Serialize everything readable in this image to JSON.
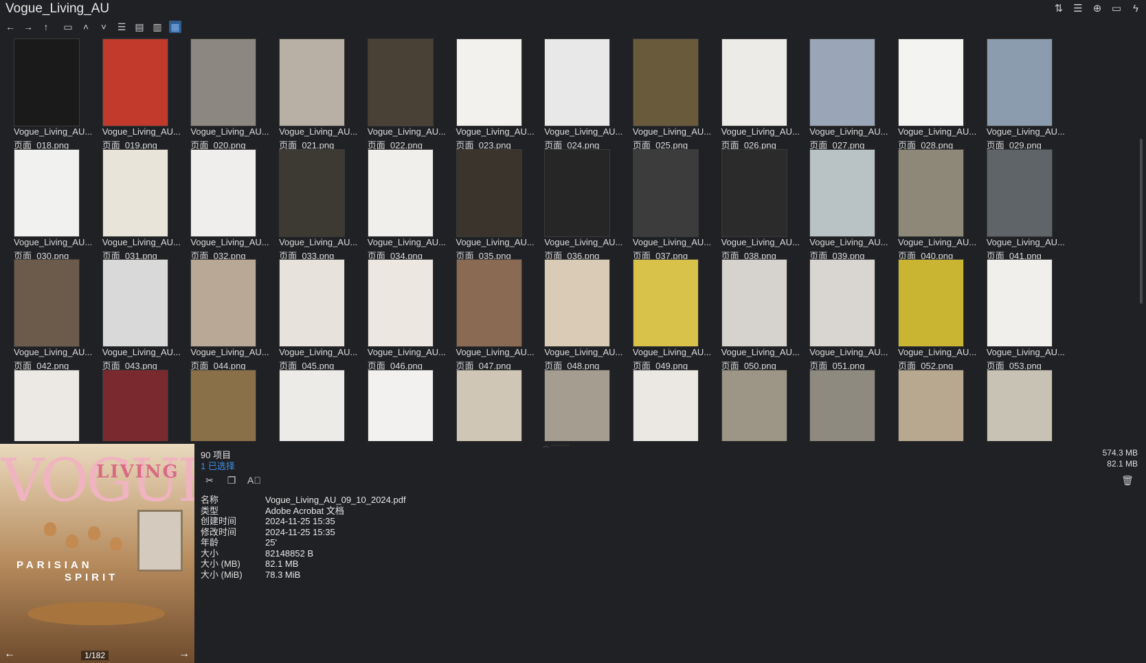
{
  "window": {
    "title": "Vogue_Living_AU"
  },
  "titlebar_icons": [
    "sort-icon",
    "details-icon",
    "add-icon",
    "clipboard-icon",
    "lightning-icon"
  ],
  "toolbar": {
    "buttons": [
      "back-icon",
      "forward-icon",
      "up-icon",
      "window-icon",
      "chevron-up-icon",
      "chevron-down-icon",
      "list-view-icon",
      "details-view-icon",
      "tree-view-icon",
      "grid-view-icon"
    ],
    "active": "grid-view-icon"
  },
  "files": [
    {
      "name": "Vogue_Living_AU...",
      "page": "页面_018.png",
      "color": "#1a1a1a"
    },
    {
      "name": "Vogue_Living_AU...",
      "page": "页面_019.png",
      "color": "#c23a2b"
    },
    {
      "name": "Vogue_Living_AU...",
      "page": "页面_020.png",
      "color": "#8c8780"
    },
    {
      "name": "Vogue_Living_AU...",
      "page": "页面_021.png",
      "color": "#b8b0a4"
    },
    {
      "name": "Vogue_Living_AU...",
      "page": "页面_022.png",
      "color": "#4a4136"
    },
    {
      "name": "Vogue_Living_AU...",
      "page": "页面_023.png",
      "color": "#f2f1ee"
    },
    {
      "name": "Vogue_Living_AU...",
      "page": "页面_024.png",
      "color": "#e8e8e8"
    },
    {
      "name": "Vogue_Living_AU...",
      "page": "页面_025.png",
      "color": "#6a5a3c"
    },
    {
      "name": "Vogue_Living_AU...",
      "page": "页面_026.png",
      "color": "#ecebe8"
    },
    {
      "name": "Vogue_Living_AU...",
      "page": "页面_027.png",
      "color": "#9aa6b8"
    },
    {
      "name": "Vogue_Living_AU...",
      "page": "页面_028.png",
      "color": "#f3f3f1"
    },
    {
      "name": "Vogue_Living_AU...",
      "page": "页面_029.png",
      "color": "#8a9cae"
    },
    {
      "name": "Vogue_Living_AU...",
      "page": "页面_030.png",
      "color": "#f1f1f0"
    },
    {
      "name": "Vogue_Living_AU...",
      "page": "页面_031.png",
      "color": "#e9e4da"
    },
    {
      "name": "Vogue_Living_AU...",
      "page": "页面_032.png",
      "color": "#efeeec"
    },
    {
      "name": "Vogue_Living_AU...",
      "page": "页面_033.png",
      "color": "#3d3a33"
    },
    {
      "name": "Vogue_Living_AU...",
      "page": "页面_034.png",
      "color": "#f0efec"
    },
    {
      "name": "Vogue_Living_AU...",
      "page": "页面_035.png",
      "color": "#3a342c"
    },
    {
      "name": "Vogue_Living_AU...",
      "page": "页面_036.png",
      "color": "#262626"
    },
    {
      "name": "Vogue_Living_AU...",
      "page": "页面_037.png",
      "color": "#3c3c3c"
    },
    {
      "name": "Vogue_Living_AU...",
      "page": "页面_038.png",
      "color": "#2b2b2b"
    },
    {
      "name": "Vogue_Living_AU...",
      "page": "页面_039.png",
      "color": "#b9c3c6"
    },
    {
      "name": "Vogue_Living_AU...",
      "page": "页面_040.png",
      "color": "#8e8878"
    },
    {
      "name": "Vogue_Living_AU...",
      "page": "页面_041.png",
      "color": "#5e6468"
    },
    {
      "name": "Vogue_Living_AU...",
      "page": "页面_042.png",
      "color": "#6c5a4a"
    },
    {
      "name": "Vogue_Living_AU...",
      "page": "页面_043.png",
      "color": "#d9d9d9"
    },
    {
      "name": "Vogue_Living_AU...",
      "page": "页面_044.png",
      "color": "#b9a896"
    },
    {
      "name": "Vogue_Living_AU...",
      "page": "页面_045.png",
      "color": "#e7e3dc"
    },
    {
      "name": "Vogue_Living_AU...",
      "page": "页面_046.png",
      "color": "#ece7e0"
    },
    {
      "name": "Vogue_Living_AU...",
      "page": "页面_047.png",
      "color": "#8a6a52"
    },
    {
      "name": "Vogue_Living_AU...",
      "page": "页面_048.png",
      "color": "#d9cbb6"
    },
    {
      "name": "Vogue_Living_AU...",
      "page": "页面_049.png",
      "color": "#d8c24a"
    },
    {
      "name": "Vogue_Living_AU...",
      "page": "页面_050.png",
      "color": "#d6d3cf"
    },
    {
      "name": "Vogue_Living_AU...",
      "page": "页面_051.png",
      "color": "#d9d6d1"
    },
    {
      "name": "Vogue_Living_AU...",
      "page": "页面_052.png",
      "color": "#c9b531"
    },
    {
      "name": "Vogue_Living_AU...",
      "page": "页面_053.png",
      "color": "#f0efec"
    },
    {
      "color": "#ece9e4"
    },
    {
      "color": "#7a2a2e"
    },
    {
      "color": "#8a7048"
    },
    {
      "color": "#ecebe8"
    },
    {
      "color": "#f2f1ef"
    },
    {
      "color": "#cfc6b6"
    },
    {
      "color": "#a49d90"
    },
    {
      "color": "#ebe8e3"
    },
    {
      "color": "#9d9585"
    },
    {
      "color": "#8f8a7f"
    },
    {
      "color": "#b8a890"
    },
    {
      "color": "#c7c2b4"
    }
  ],
  "preview": {
    "logo": "VOGUE",
    "sub_logo": "LIVING",
    "headline_1": "PARISIAN",
    "headline_2": "SPIRIT",
    "page_indicator": "1/182"
  },
  "status": {
    "item_count": "90 项目",
    "selected": "1 已选择",
    "total_size": "574.3 MB",
    "selected_size": "82.1 MB"
  },
  "properties": [
    {
      "label": "名称",
      "value": "Vogue_Living_AU_09_10_2024.pdf"
    },
    {
      "label": "类型",
      "value": "Adobe Acrobat 文档"
    },
    {
      "label": "创建时间",
      "value": "2024-11-25  15:35"
    },
    {
      "label": "修改时间",
      "value": "2024-11-25  15:35"
    },
    {
      "label": "年龄",
      "value": "25'"
    },
    {
      "label": "大小",
      "value": "82148852 B"
    },
    {
      "label": "大小 (MB)",
      "value": "82.1 MB"
    },
    {
      "label": "大小 (MiB)",
      "value": "78.3 MiB"
    }
  ]
}
